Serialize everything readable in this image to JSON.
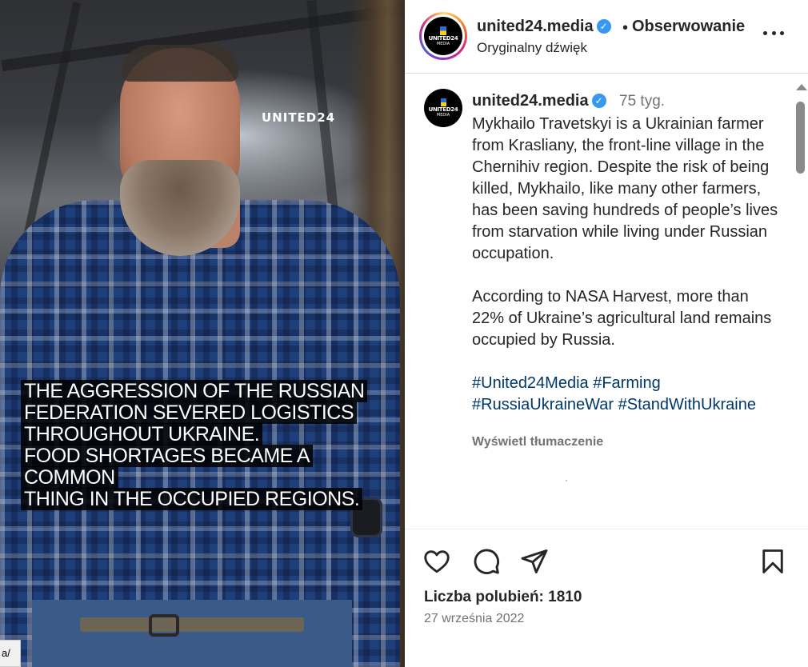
{
  "media": {
    "brand_overlay": "UNITED24",
    "caption_lines": [
      "THE AGGRESSION OF THE RUSSIAN",
      "FEDERATION SEVERED LOGISTICS",
      "THROUGHOUT UKRAINE.",
      "FOOD SHORTAGES BECAME A COMMON",
      "THING IN THE OCCUPIED REGIONS."
    ],
    "url_fragment": "a/"
  },
  "header": {
    "username": "united24.media",
    "separator": "•",
    "follow_label": "Obserwowanie",
    "audio_label": "Oryginalny dźwięk",
    "avatar_text": "UNITED24",
    "avatar_subtext": "MEDIA"
  },
  "post": {
    "author": "united24.media",
    "age": "75 tyg.",
    "paragraph1": "Mykhailo Travetskyi is a Ukrainian farmer from Krasliany, the front-line village in the Chernihiv region. Despite the risk of being killed, Mykhailo, like many other farmers, has been saving hundreds of people’s lives from starvation while living under Russian occupation.",
    "paragraph2": "According to NASA Harvest, more than 22% of Ukraine’s agricultural land remains occupied by Russia.",
    "hashtags": [
      "#United24Media",
      "#Farming",
      "#RussiaUkraineWar",
      "#StandWithUkraine"
    ],
    "translate_label": "Wyświetl tłumaczenie"
  },
  "footer": {
    "likes_text": "Liczba polubień: 1810",
    "date_text": "27 września 2022"
  },
  "colors": {
    "verified_blue": "#3897f0",
    "hashtag_blue": "#00376b",
    "muted_text": "#737373",
    "primary_text": "#262626"
  },
  "icons": [
    "verified-icon",
    "more-icon",
    "heart-icon",
    "comment-icon",
    "share-icon",
    "bookmark-icon",
    "scroll-up-arrow-icon"
  ]
}
